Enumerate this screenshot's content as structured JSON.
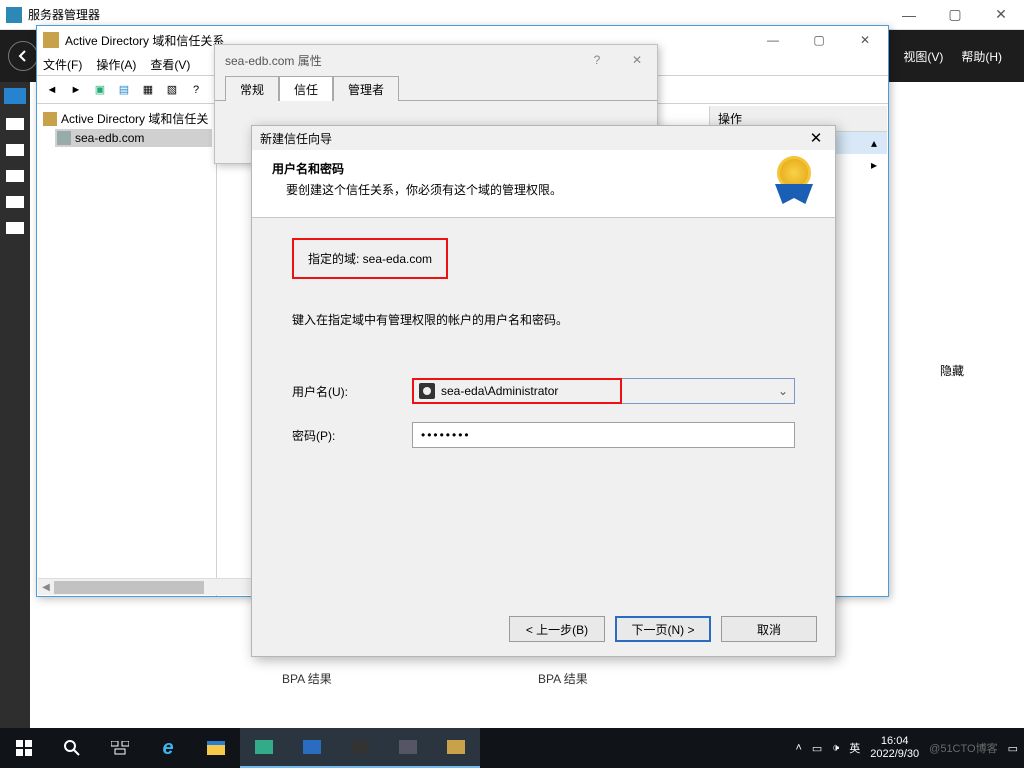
{
  "server_manager": {
    "title": "服务器管理器",
    "menu": {
      "view": "视图(V)",
      "help": "帮助(H)"
    },
    "hidden_label": "隐藏"
  },
  "ad_window": {
    "title": "Active Directory 域和信任关系",
    "menubar": {
      "file": "文件(F)",
      "action": "操作(A)",
      "view": "查看(V)"
    },
    "tree_root": "Active Directory 域和信任关",
    "tree_child": "sea-edb.com",
    "actions_header": "操作"
  },
  "properties": {
    "title": "sea-edb.com 属性",
    "tabs": {
      "general": "常规",
      "trust": "信任",
      "admin": "管理者"
    }
  },
  "wizard": {
    "title": "新建信任向导",
    "heading": "用户名和密码",
    "subheading": "要创建这个信任关系，你必须有这个域的管理权限。",
    "domain_label": "指定的域: sea-eda.com",
    "instruction": "键入在指定域中有管理权限的帐户的用户名和密码。",
    "username_label": "用户名(U):",
    "username_value": "sea-eda\\Administrator",
    "password_label": "密码(P):",
    "password_value": "••••••••",
    "buttons": {
      "back": "< 上一步(B)",
      "next": "下一页(N) >",
      "cancel": "取消"
    }
  },
  "bpa": {
    "left": "BPA 结果",
    "right": "BPA 结果"
  },
  "taskbar": {
    "ime": "英",
    "time": "16:04",
    "date": "2022/9/30",
    "watermark": "@51CTO博客"
  }
}
